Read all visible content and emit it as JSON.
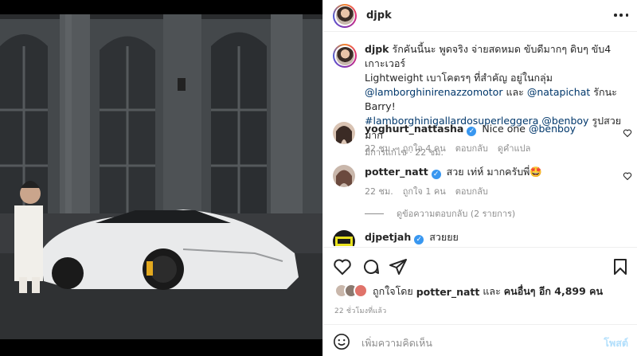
{
  "post": {
    "username": "djpk"
  },
  "caption": {
    "username": "djpk",
    "line1": "รักคันนี้นะ พูดจริง จ่ายสดหมด ขับดีมากๆ ดิบๆ ขับ4 เกาะเวอร์",
    "line2": "Lightweight เบาโคตรๆ ที่สำคัญ อยู่ในกลุ่ม",
    "mention1": "@lamborghinirenazzomotor",
    "and": "และ",
    "mention2": "@natapichat",
    "thanks": "รักนะ Barry!",
    "hashtag": "#lamborghinigallardosuperleggera",
    "mention3": "@benboy",
    "tail": "รูปสวยมาก",
    "meta": "มีการแก้ไข · 22 ชม."
  },
  "comments": [
    {
      "username": "yoghurt_nattasha",
      "text": "Nice one",
      "mention": "@benboy",
      "time": "22 ชม.",
      "likes": "ถูกใจ 4 คน",
      "reply": "ตอบกลับ",
      "translate": "ดูคำแปล"
    },
    {
      "username": "potter_natt",
      "text": "สวย เท่ห์ มากครับพี่🤩",
      "time": "22 ชม.",
      "likes": "ถูกใจ 1 คน",
      "reply": "ตอบกลับ",
      "view_replies": "ดูข้อความตอบกลับ (2 รายการ)"
    },
    {
      "username": "djpetjah",
      "text": "สวยยย"
    }
  ],
  "likes_line": {
    "prefix": "ถูกใจโดย",
    "user": "potter_natt",
    "and": "และ",
    "others": "คนอื่นๆ อีก 4,899 คน"
  },
  "timestamp": "22 ชั่วโมงที่แล้ว",
  "add_comment": {
    "placeholder": "เพิ่มความคิดเห็น",
    "post_label": "โพสต์"
  },
  "icons": {
    "more": "more-horizontal-icon",
    "heart": "heart-icon",
    "comment": "comment-icon",
    "share": "share-icon",
    "save": "bookmark-icon",
    "emoji": "emoji-icon",
    "verified": "verified-badge-icon"
  },
  "colors": {
    "link": "#00376b",
    "verified": "#3897f0",
    "muted": "#8e8e8e",
    "post_disabled": "#b2dffc"
  }
}
